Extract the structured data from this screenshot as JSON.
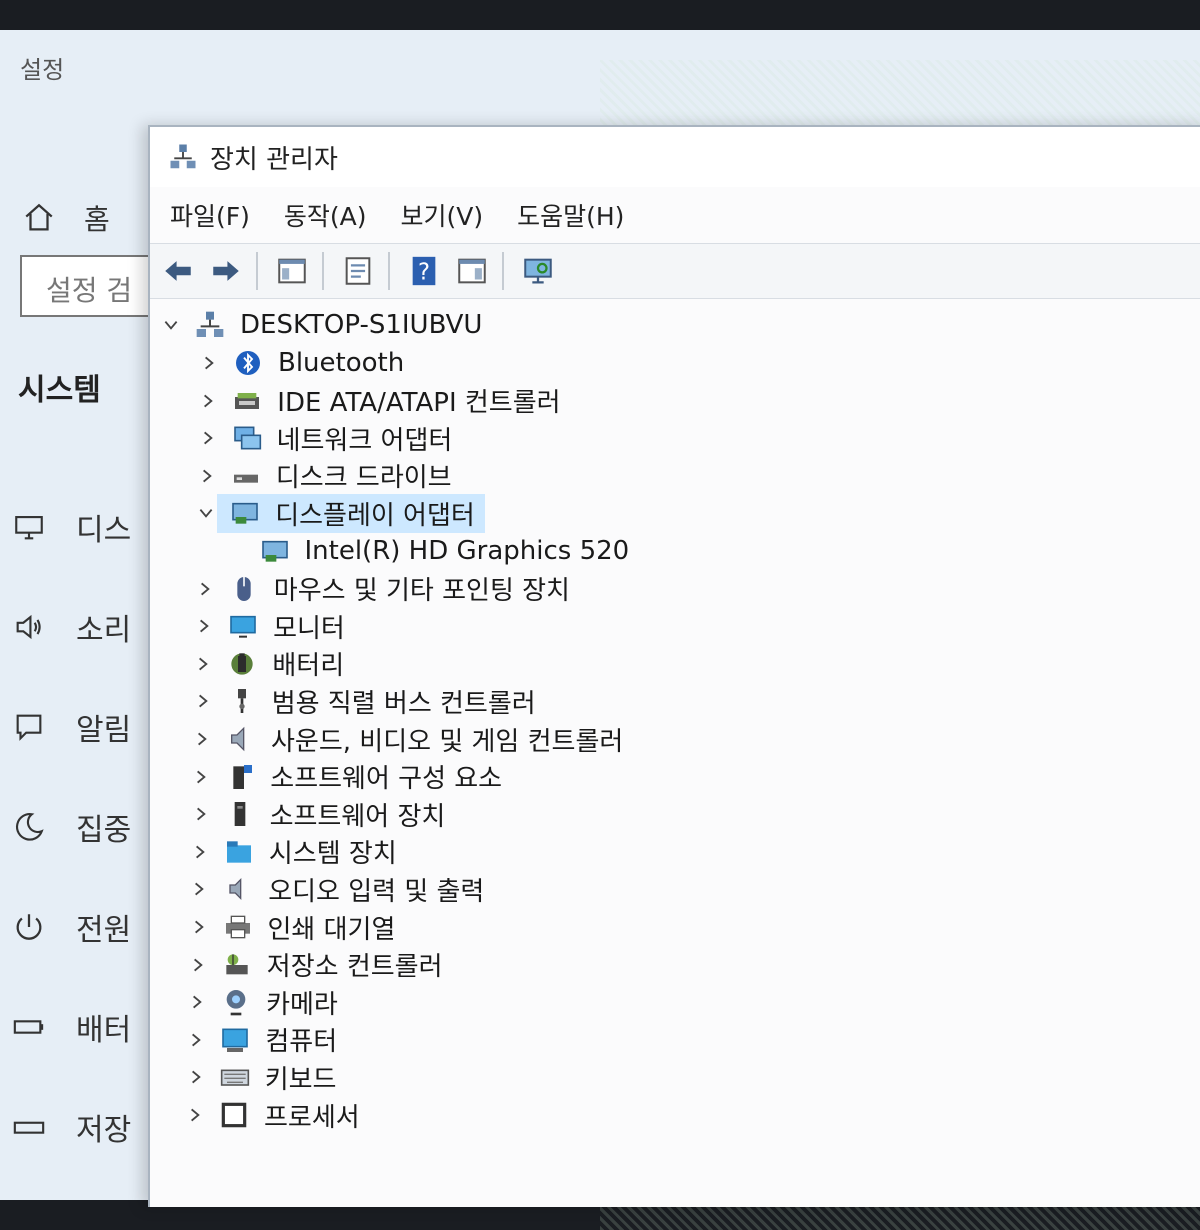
{
  "settings": {
    "title": "설정",
    "home_label": "홈",
    "search_placeholder": "설정 검",
    "section_label": "시스템",
    "nav_items": [
      {
        "label": "디스",
        "icon": "monitor-icon"
      },
      {
        "label": "소리",
        "icon": "speaker-icon"
      },
      {
        "label": "알림",
        "icon": "notification-icon"
      },
      {
        "label": "집중",
        "icon": "moon-icon"
      },
      {
        "label": "전원",
        "icon": "power-icon"
      },
      {
        "label": "배터",
        "icon": "battery-icon"
      },
      {
        "label": "저장",
        "icon": "storage-icon"
      }
    ]
  },
  "device_manager": {
    "title": "장치 관리자",
    "menu": [
      "파일(F)",
      "동작(A)",
      "보기(V)",
      "도움말(H)"
    ],
    "toolbar": [
      "back-arrow-icon",
      "forward-arrow-icon",
      "show-hide-tree-icon",
      "properties-icon",
      "help-icon",
      "action-pane-icon",
      "scan-hardware-icon"
    ],
    "root": "DESKTOP-S1IUBVU",
    "categories": [
      {
        "label": "Bluetooth",
        "icon": "bluetooth-icon",
        "expanded": false
      },
      {
        "label": "IDE ATA/ATAPI 컨트롤러",
        "icon": "ide-controller-icon",
        "expanded": false
      },
      {
        "label": "네트워크 어댑터",
        "icon": "network-adapter-icon",
        "expanded": false
      },
      {
        "label": "디스크 드라이브",
        "icon": "disk-drive-icon",
        "expanded": false
      },
      {
        "label": "디스플레이 어댑터",
        "icon": "display-adapter-icon",
        "expanded": true,
        "selected": true
      },
      {
        "label": "Intel(R) HD Graphics 520",
        "icon": "display-adapter-icon",
        "child": true
      },
      {
        "label": "마우스 및 기타 포인팅 장치",
        "icon": "mouse-icon",
        "expanded": false
      },
      {
        "label": "모니터",
        "icon": "monitor-icon",
        "expanded": false
      },
      {
        "label": "배터리",
        "icon": "battery-icon",
        "expanded": false
      },
      {
        "label": "범용 직렬 버스 컨트롤러",
        "icon": "usb-icon",
        "expanded": false
      },
      {
        "label": "사운드, 비디오 및 게임 컨트롤러",
        "icon": "speaker-icon",
        "expanded": false
      },
      {
        "label": "소프트웨어 구성 요소",
        "icon": "software-component-icon",
        "expanded": false
      },
      {
        "label": "소프트웨어 장치",
        "icon": "software-device-icon",
        "expanded": false
      },
      {
        "label": "시스템 장치",
        "icon": "system-device-icon",
        "expanded": false
      },
      {
        "label": "오디오 입력 및 출력",
        "icon": "audio-io-icon",
        "expanded": false
      },
      {
        "label": "인쇄 대기열",
        "icon": "printer-icon",
        "expanded": false
      },
      {
        "label": "저장소 컨트롤러",
        "icon": "storage-controller-icon",
        "expanded": false
      },
      {
        "label": "카메라",
        "icon": "camera-icon",
        "expanded": false
      },
      {
        "label": "컴퓨터",
        "icon": "computer-icon",
        "expanded": false
      },
      {
        "label": "키보드",
        "icon": "keyboard-icon",
        "expanded": false
      },
      {
        "label": "프로세서",
        "icon": "processor-icon",
        "expanded": false
      }
    ]
  },
  "colors": {
    "selection": "#cde8ff",
    "settings_bg": "#e6eef6",
    "window_bg": "#fbfbfc"
  }
}
